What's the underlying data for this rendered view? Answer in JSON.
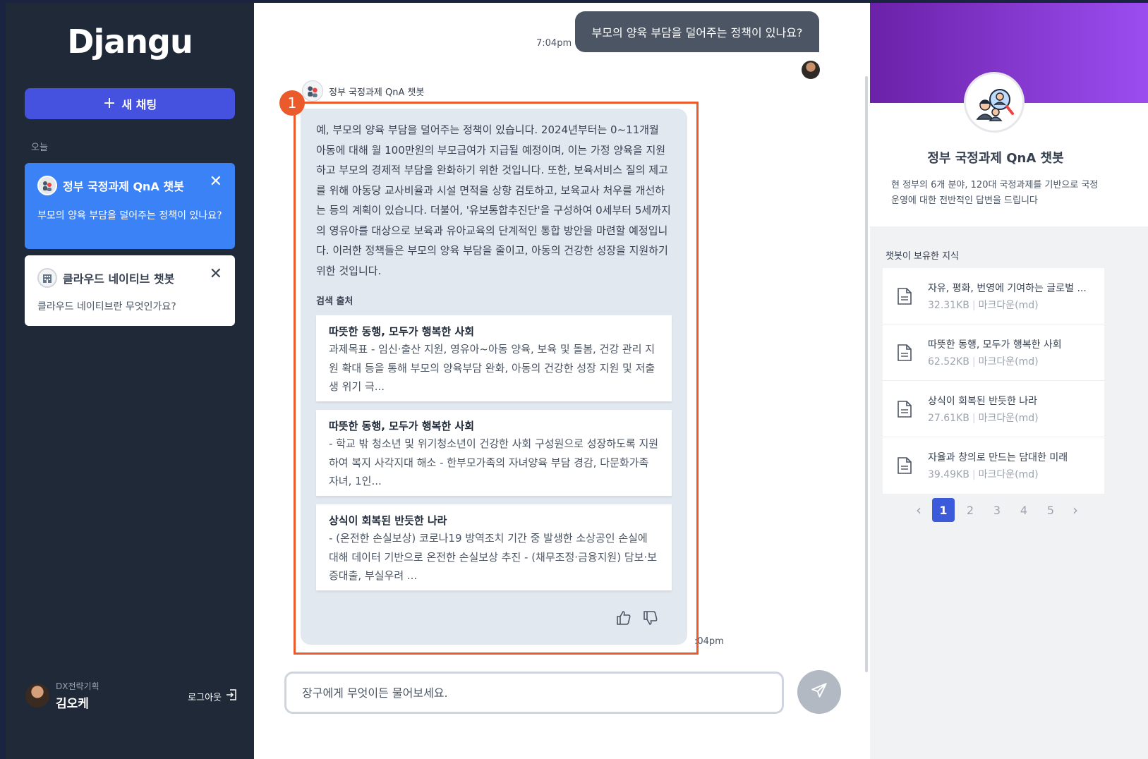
{
  "sidebar": {
    "logo": "Djangu",
    "new_chat_label": "새 채팅",
    "section_today": "오늘",
    "chats": [
      {
        "title": "정부 국정과제 QnA 챗봇",
        "preview": "부모의 양육 부담을 덜어주는 정책이 있나요?",
        "active": true
      },
      {
        "title": "클라우드 네이티브 챗봇",
        "preview": "클라우드 네이티브란 무엇인가요?",
        "active": false
      }
    ],
    "user": {
      "dept": "DX전략기획",
      "name": "김오케"
    },
    "logout_label": "로그아웃"
  },
  "chat": {
    "user_message": "부모의 양육 부담을 덜어주는 정책이 있나요?",
    "user_time": "7:04pm",
    "bot_name": "정부 국정과제 QnA 챗봇",
    "bot_answer": "예, 부모의 양육 부담을 덜어주는 정책이 있습니다. 2024년부터는 0~11개월 아동에 대해 월 100만원의 부모급여가 지급될 예정이며, 이는 가정 양육을 지원하고 부모의 경제적 부담을 완화하기 위한 것입니다. 또한, 보육서비스 질의 제고를 위해 아동당 교사비율과 시설 면적을 상향 검토하고, 보육교사 처우를 개선하는 등의 계획이 있습니다. 더불어, '유보통합추진단'을 구성하여 0세부터 5세까지의 영유아를 대상으로 보육과 유아교육의 단계적인 통합 방안을 마련할 예정입니다. 이러한 정책들은 부모의 양육 부담을 줄이고, 아동의 건강한 성장을 지원하기 위한 것입니다.",
    "sources_label": "검색 출처",
    "sources": [
      {
        "title": "따뜻한 동행, 모두가 행복한 사회",
        "text": "과제목표 - 임신·출산 지원, 영유아~아동 양육, 보육 및 돌봄, 건강 관리 지원 확대 등을 통해 부모의 양육부담 완화, 아동의 건강한 성장 지원 및 저출생 위기 극..."
      },
      {
        "title": "따뜻한 동행, 모두가 행복한 사회",
        "text": "- 학교 밖 청소년 및 위기청소년이 건강한 사회 구성원으로 성장하도록 지원하여 복지 사각지대 해소 - 한부모가족의 자녀양육 부담 경감, 다문화가족 자녀, 1인..."
      },
      {
        "title": "상식이 회복된 반듯한 나라",
        "text": "- (온전한 손실보상) 코로나19 방역조치 기간 중 발생한 소상공인 손실에 대해 데이터 기반으로 온전한 손실보상 추진 - (채무조정·금융지원) 담보·보증대출, 부실우려 ..."
      }
    ],
    "bot_time": ":04pm",
    "annotation_number": "1",
    "input_placeholder": "장구에게 무엇이든 물어보세요."
  },
  "right_panel": {
    "bot_title": "정부 국정과제 QnA 챗봇",
    "bot_desc": "현 정부의 6개 분야, 120대 국정과제를 기반으로 국정 운영에 대한 전반적인 답변을 드립니다",
    "knowledge_label": "챗봇이 보유한 지식",
    "files": [
      {
        "name": "자유, 평화, 번영에 기여하는 글로벌 ...",
        "size": "32.31KB",
        "type": "마크다운(md)"
      },
      {
        "name": "따뜻한 동행, 모두가 행복한 사회",
        "size": "62.52KB",
        "type": "마크다운(md)"
      },
      {
        "name": "상식이 회복된 반듯한 나라",
        "size": "27.61KB",
        "type": "마크다운(md)"
      },
      {
        "name": "자율과 창의로 만드는 담대한 미래",
        "size": "39.49KB",
        "type": "마크다운(md)"
      }
    ],
    "pages": [
      "1",
      "2",
      "3",
      "4",
      "5"
    ],
    "current_page": "1"
  },
  "colors": {
    "sidebar_bg": "#1f2937",
    "accent": "#4552e0",
    "active_card": "#3b82f6",
    "highlight": "#ea5a2a",
    "hero_gradient": [
      "#6b21a8",
      "#9b4df0"
    ]
  },
  "icons": [
    "plus-icon",
    "close-icon",
    "bot-avatar-icon",
    "building-icon",
    "logout-icon",
    "send-icon",
    "thumbs-up-icon",
    "thumbs-down-icon",
    "document-icon",
    "chevron-left-icon",
    "chevron-right-icon"
  ]
}
